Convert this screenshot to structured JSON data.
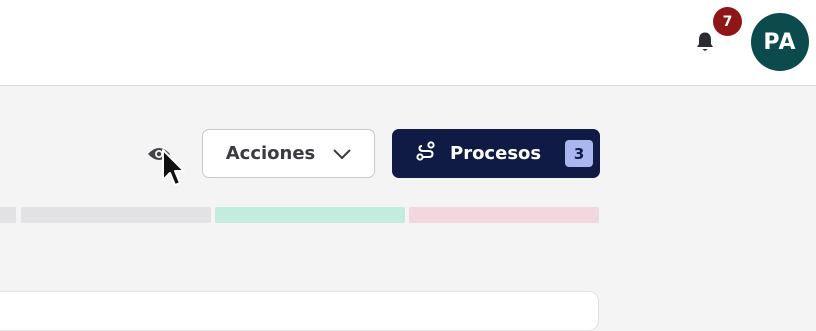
{
  "header": {
    "notification_count": "7",
    "user_initials": "PA"
  },
  "toolbar": {
    "actions_label": "Acciones",
    "processes_label": "Procesos",
    "processes_count": "3"
  },
  "icons": [
    "bell-icon",
    "eye-icon",
    "chevron-down-icon",
    "route-icon",
    "mouse-cursor"
  ],
  "colors": {
    "accent_dark": "#0f1b45",
    "badge_red": "#8e1518",
    "avatar_teal": "#0c4b4d",
    "status_gray": "#e2e2e5",
    "status_green": "#c3ebde",
    "status_red": "#f2d8de"
  }
}
